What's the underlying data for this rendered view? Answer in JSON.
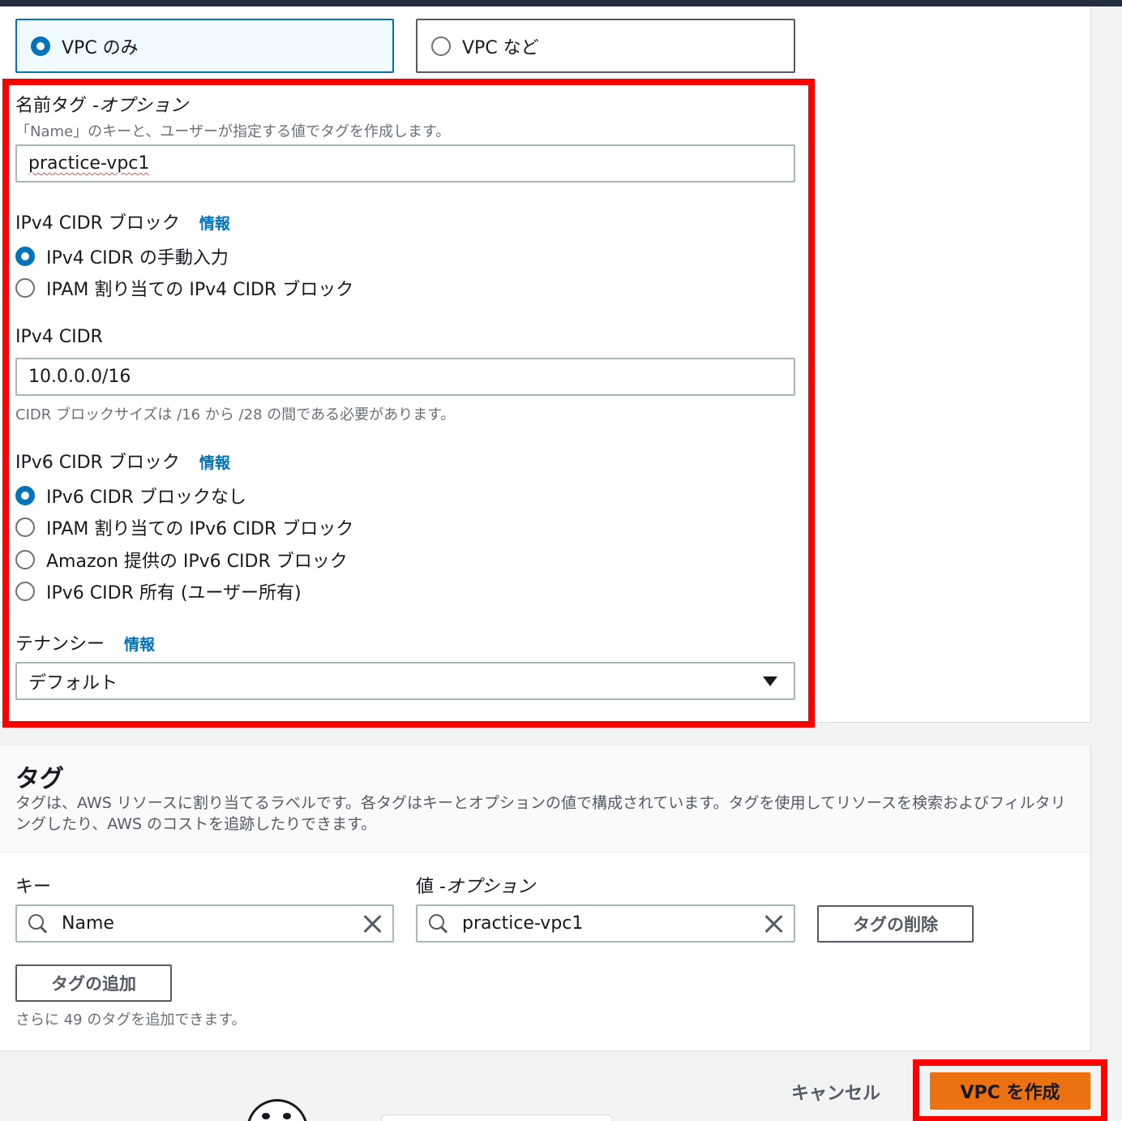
{
  "resource_options": {
    "vpc_only": "VPC のみ",
    "vpc_and_more": "VPC など",
    "selected": "VPC のみ"
  },
  "name_tag": {
    "label": "名前タグ - ",
    "optional": "オプション",
    "description": "「Name」のキーと、ユーザーが指定する値でタグを作成します。",
    "value": "practice-vpc1"
  },
  "ipv4_block": {
    "label": "IPv4 CIDR ブロック",
    "info": "情報",
    "options": [
      "IPv4 CIDR の手動入力",
      "IPAM 割り当ての IPv4 CIDR ブロック"
    ],
    "selected": "IPv4 CIDR の手動入力"
  },
  "ipv4_cidr": {
    "label": "IPv4 CIDR",
    "value": "10.0.0.0/16",
    "hint": "CIDR ブロックサイズは /16 から /28 の間である必要があります。"
  },
  "ipv6_block": {
    "label": "IPv6 CIDR ブロック",
    "info": "情報",
    "options": [
      "IPv6 CIDR ブロックなし",
      "IPAM 割り当ての IPv6 CIDR ブロック",
      "Amazon 提供の IPv6 CIDR ブロック",
      "IPv6 CIDR 所有 (ユーザー所有)"
    ],
    "selected": "IPv6 CIDR ブロックなし"
  },
  "tenancy": {
    "label": "テナンシー",
    "info": "情報",
    "value": "デフォルト"
  },
  "tags": {
    "title": "タグ",
    "description": "タグは、AWS リソースに割り当てるラベルです。各タグはキーとオプションの値で構成されています。タグを使用してリソースを検索およびフィルタリングしたり、AWS のコストを追跡したりできます。",
    "key_label": "キー",
    "value_label": "値 - ",
    "value_optional": "オプション",
    "key_value": "Name",
    "value_value": "practice-vpc1",
    "remove_button": "タグの削除",
    "add_button": "タグの追加",
    "remaining": "さらに 49 のタグを追加できます。"
  },
  "footer": {
    "cancel": "キャンセル",
    "create": "VPC を作成"
  },
  "colors": {
    "accent": "#0073bb",
    "primary_button": "#ec7211",
    "highlight": "#ff0000"
  }
}
